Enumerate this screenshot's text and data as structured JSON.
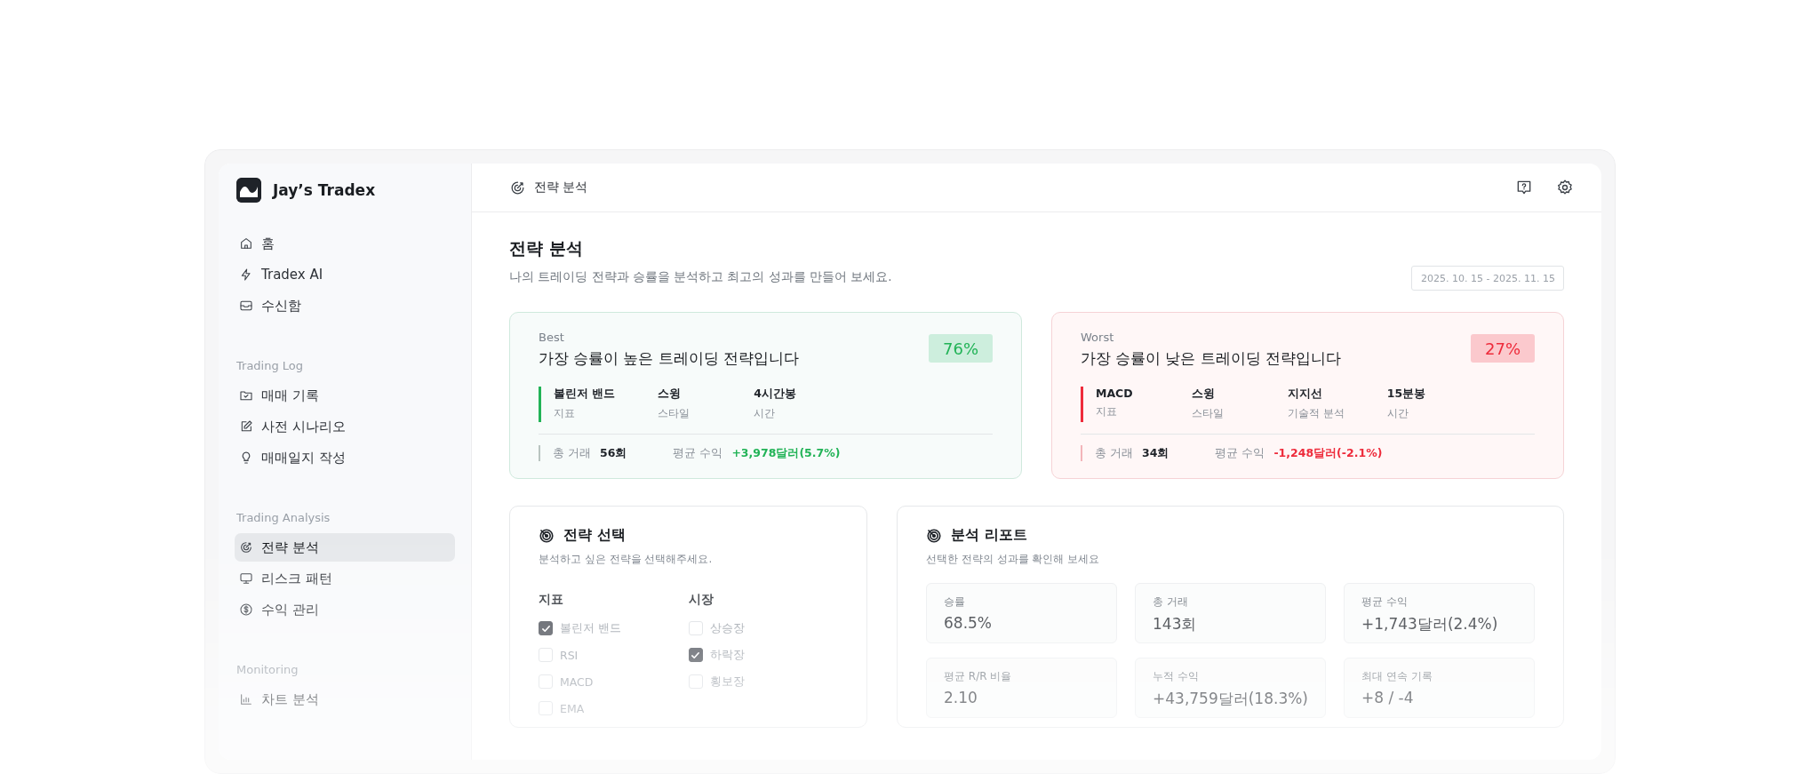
{
  "sidebar": {
    "brand": "Jay’s Tradex",
    "groups": [
      {
        "items": [
          {
            "label": "홈",
            "selected": false
          },
          {
            "label": "Tradex AI",
            "selected": false
          },
          {
            "label": "수신함",
            "selected": false
          }
        ]
      },
      {
        "heading": "Trading Log",
        "items": [
          {
            "label": "매매 기록",
            "selected": false
          },
          {
            "label": "사전 시나리오",
            "selected": false
          },
          {
            "label": "매매일지 작성",
            "selected": false
          }
        ]
      },
      {
        "heading": "Trading Analysis",
        "items": [
          {
            "label": "전략 분석",
            "selected": true
          },
          {
            "label": "리스크 패턴",
            "selected": false
          },
          {
            "label": "수익 관리",
            "selected": false
          }
        ]
      },
      {
        "heading": "Monitoring",
        "items": [
          {
            "label": "차트 분석",
            "selected": false
          }
        ]
      }
    ]
  },
  "header": {
    "title": "전략 분석"
  },
  "page": {
    "title": "전략 분석",
    "subtitle": "나의 트레이딩 전략과 승률을 분석하고 최고의 성과를 만들어 보세요.",
    "date_range": "2025. 10. 15 - 2025. 11. 15"
  },
  "highlight_cards": [
    {
      "kind": "best",
      "tag": "Best",
      "title": "가장 승률이 높은 트레이딩 전략입니다",
      "rate": "76%",
      "attributes": [
        {
          "value": "볼린저 밴드",
          "label": "지표"
        },
        {
          "value": "스윙",
          "label": "스타일"
        },
        {
          "value": "4시간봉",
          "label": "시간"
        }
      ],
      "total_label": "총 거래",
      "total_value": "56회",
      "avg_label": "평균 수익",
      "avg_value": "+3,978달러(5.7%)"
    },
    {
      "kind": "worst",
      "tag": "Worst",
      "title": "가장 승률이 낮은 트레이딩 전략입니다",
      "rate": "27%",
      "attributes": [
        {
          "value": "MACD",
          "label": "지표"
        },
        {
          "value": "스윙",
          "label": "스타일"
        },
        {
          "value": "지지선",
          "label": "기술적 분석"
        },
        {
          "value": "15분봉",
          "label": "시간"
        }
      ],
      "total_label": "총 거래",
      "total_value": "34회",
      "avg_label": "평균 수익",
      "avg_value": "-1,248달러(-2.1%)"
    }
  ],
  "strategy_select": {
    "title": "전략 선택",
    "subtitle": "분석하고 싶은 전략을 선택해주세요.",
    "groups": [
      {
        "heading": "지표",
        "options": [
          {
            "label": "볼린저 밴드",
            "checked": true
          },
          {
            "label": "RSI",
            "checked": false
          },
          {
            "label": "MACD",
            "checked": false
          },
          {
            "label": "EMA",
            "checked": false
          }
        ]
      },
      {
        "heading": "시장",
        "options": [
          {
            "label": "상승장",
            "checked": false
          },
          {
            "label": "하락장",
            "checked": true
          },
          {
            "label": "횡보장",
            "checked": false
          }
        ]
      }
    ]
  },
  "report": {
    "title": "분석 리포트",
    "subtitle": "선택한 전략의 성과를 확인해 보세요",
    "metrics": [
      {
        "label": "승률",
        "value": "68.5%"
      },
      {
        "label": "총 거래",
        "value": "143회"
      },
      {
        "label": "평균 수익",
        "value": "+1,743달러(2.4%)"
      },
      {
        "label": "평균 R/R 비율",
        "value": "2.10"
      },
      {
        "label": "누적 수익",
        "value": "+43,759달러(18.3%)"
      },
      {
        "label": "최대 연속 기록",
        "value": "+8 / -4"
      }
    ]
  }
}
